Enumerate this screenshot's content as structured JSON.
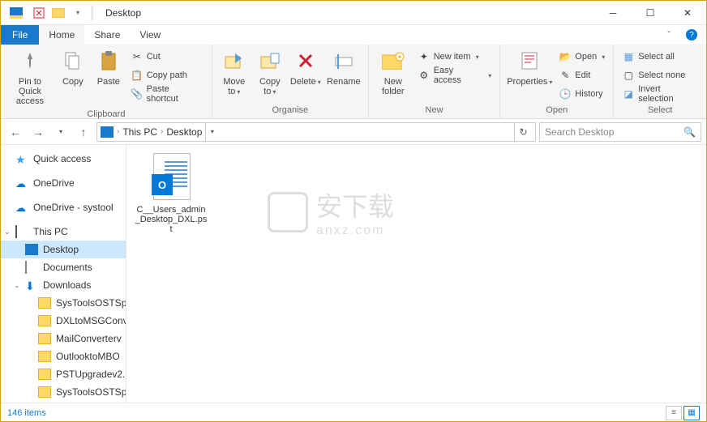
{
  "window": {
    "title": "Desktop",
    "tabs": {
      "file": "File",
      "home": "Home",
      "share": "Share",
      "view": "View"
    }
  },
  "ribbon": {
    "clipboard": {
      "label": "Clipboard",
      "pin": "Pin to Quick access",
      "copy": "Copy",
      "paste": "Paste",
      "cut": "Cut",
      "copy_path": "Copy path",
      "paste_shortcut": "Paste shortcut"
    },
    "organise": {
      "label": "Organise",
      "move_to": "Move to",
      "copy_to": "Copy to",
      "delete": "Delete",
      "rename": "Rename"
    },
    "new": {
      "label": "New",
      "new_folder": "New folder",
      "new_item": "New item",
      "easy_access": "Easy access"
    },
    "open": {
      "label": "Open",
      "properties": "Properties",
      "open": "Open",
      "edit": "Edit",
      "history": "History"
    },
    "select": {
      "label": "Select",
      "select_all": "Select all",
      "select_none": "Select none",
      "invert": "Invert selection"
    }
  },
  "address": {
    "crumbs": [
      "This PC",
      "Desktop"
    ],
    "search_placeholder": "Search Desktop"
  },
  "nav": {
    "quick_access": "Quick access",
    "onedrive": "OneDrive",
    "onedrive_systool": "OneDrive - systool",
    "this_pc": "This PC",
    "desktop": "Desktop",
    "documents": "Documents",
    "downloads": "Downloads",
    "dl_items": [
      "SysToolsOSTSp",
      "DXLtoMSGConv",
      "MailConverterv",
      "OutlooktoMBO",
      "PSTUpgradev2.",
      "SysToolsOSTSp"
    ]
  },
  "files": [
    {
      "name": "C__Users_admin_Desktop_DXL.pst"
    }
  ],
  "status": {
    "count": "146 items"
  }
}
